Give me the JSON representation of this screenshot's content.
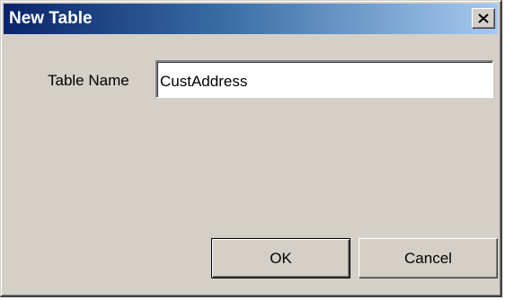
{
  "window": {
    "title": "New Table",
    "close_icon": "close-icon"
  },
  "form": {
    "table_name_label": "Table Name",
    "table_name_value": "CustAddress"
  },
  "buttons": {
    "ok_label": "OK",
    "cancel_label": "Cancel"
  },
  "colors": {
    "titlebar_start": "#0a246a",
    "titlebar_end": "#a6caf0",
    "dialog_face": "#d4d0c8"
  }
}
